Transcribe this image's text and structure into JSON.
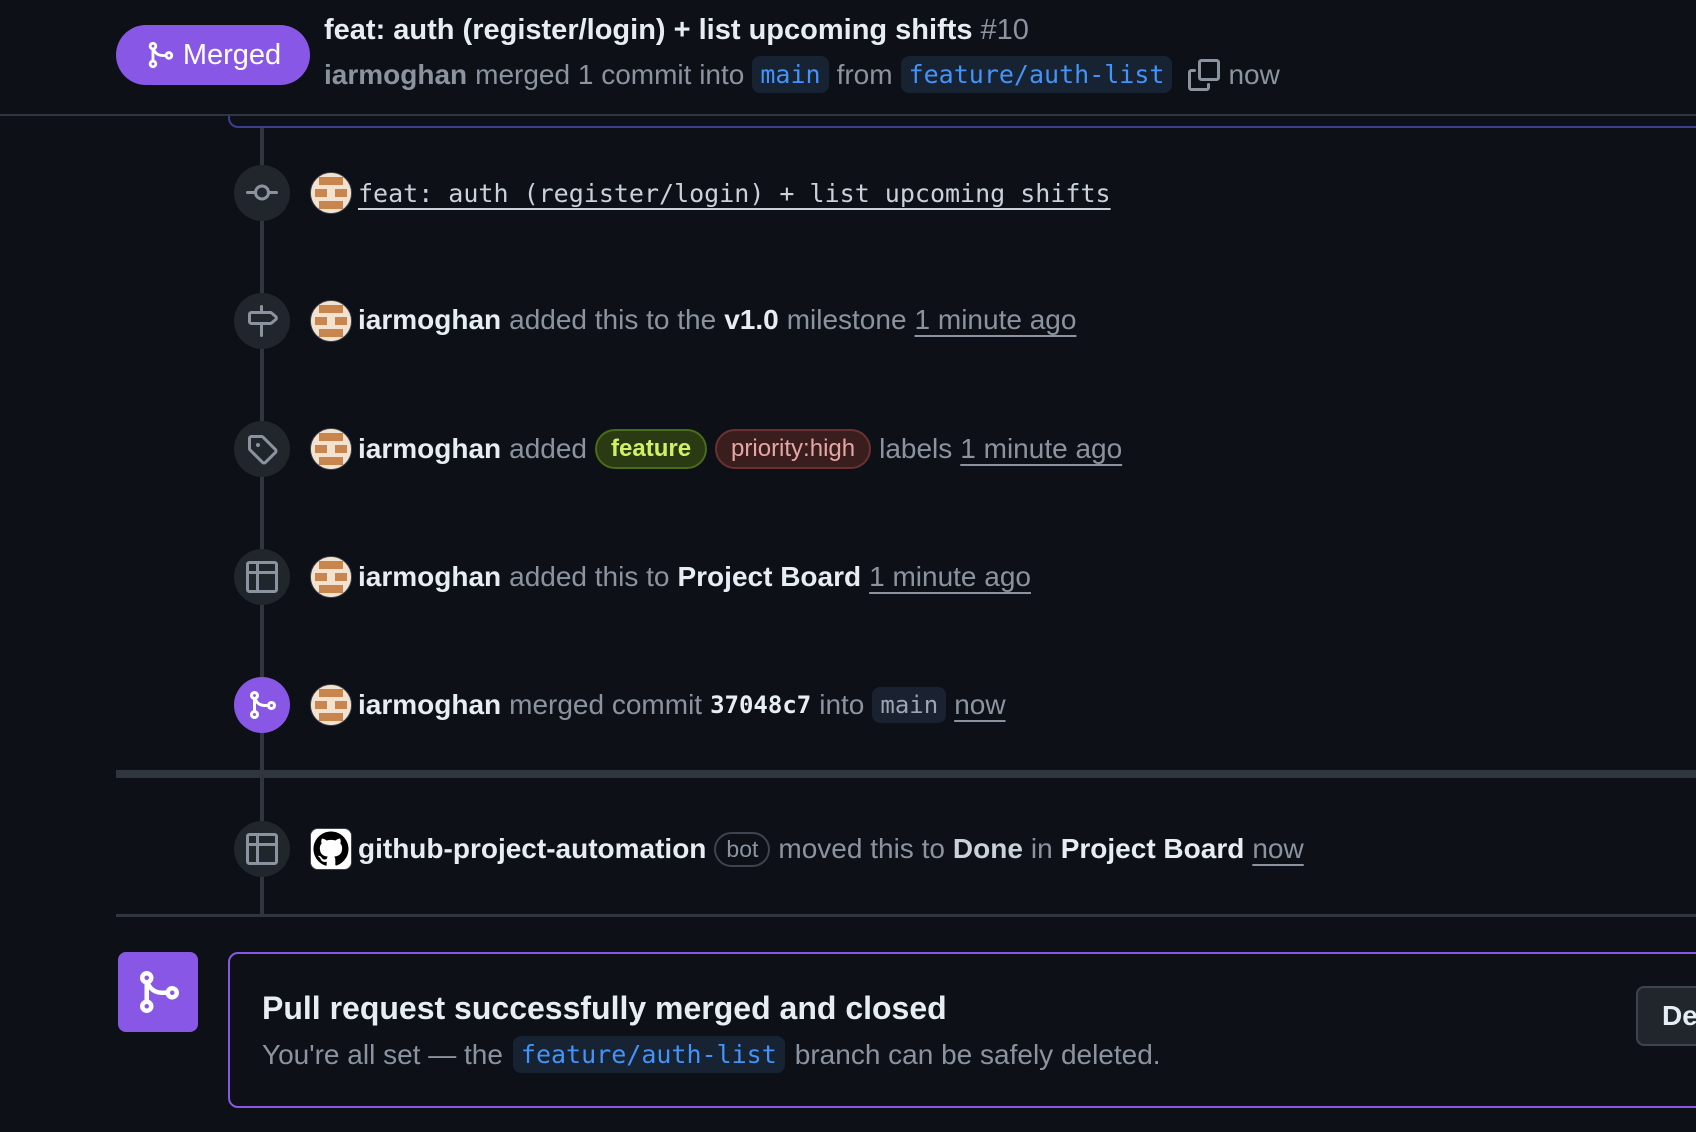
{
  "header": {
    "state": "Merged",
    "title": "feat: auth (register/login) + list upcoming shifts",
    "number": "#10",
    "author": "iarmoghan",
    "merged_text": "merged 1 commit into",
    "base_branch": "main",
    "from_text": "from",
    "head_branch": "feature/auth-list",
    "time": "now"
  },
  "timeline": {
    "commit": {
      "message": "feat: auth (register/login) + list upcoming shifts"
    },
    "milestone": {
      "user": "iarmoghan",
      "text_before": "added this to the",
      "milestone": "v1.0",
      "text_after": "milestone",
      "time": "1 minute ago"
    },
    "labels": {
      "user": "iarmoghan",
      "text_before": "added",
      "text_after": "labels",
      "time": "1 minute ago",
      "items": [
        {
          "name": "feature",
          "color": "#d0f065"
        },
        {
          "name": "priority:high",
          "color": "#e5a6a6"
        }
      ]
    },
    "project": {
      "user": "iarmoghan",
      "text_before": "added this to",
      "project": "Project Board",
      "time": "1 minute ago"
    },
    "merged": {
      "user": "iarmoghan",
      "text_before": "merged commit",
      "sha": "37048c7",
      "text_into": "into",
      "branch": "main",
      "time": "now"
    },
    "moved": {
      "user": "github-project-automation",
      "bot": "bot",
      "text_before": "moved this to",
      "column": "Done",
      "text_in": "in",
      "project": "Project Board",
      "time": "now"
    }
  },
  "merge_box": {
    "title": "Pull request successfully merged and closed",
    "desc_before": "You're all set — the",
    "branch": "feature/auth-list",
    "desc_after": "branch can be safely deleted.",
    "delete_button": "De"
  },
  "colors": {
    "merged": "#8957e5",
    "link_blue": "#4493f8",
    "background": "#0d1117"
  }
}
